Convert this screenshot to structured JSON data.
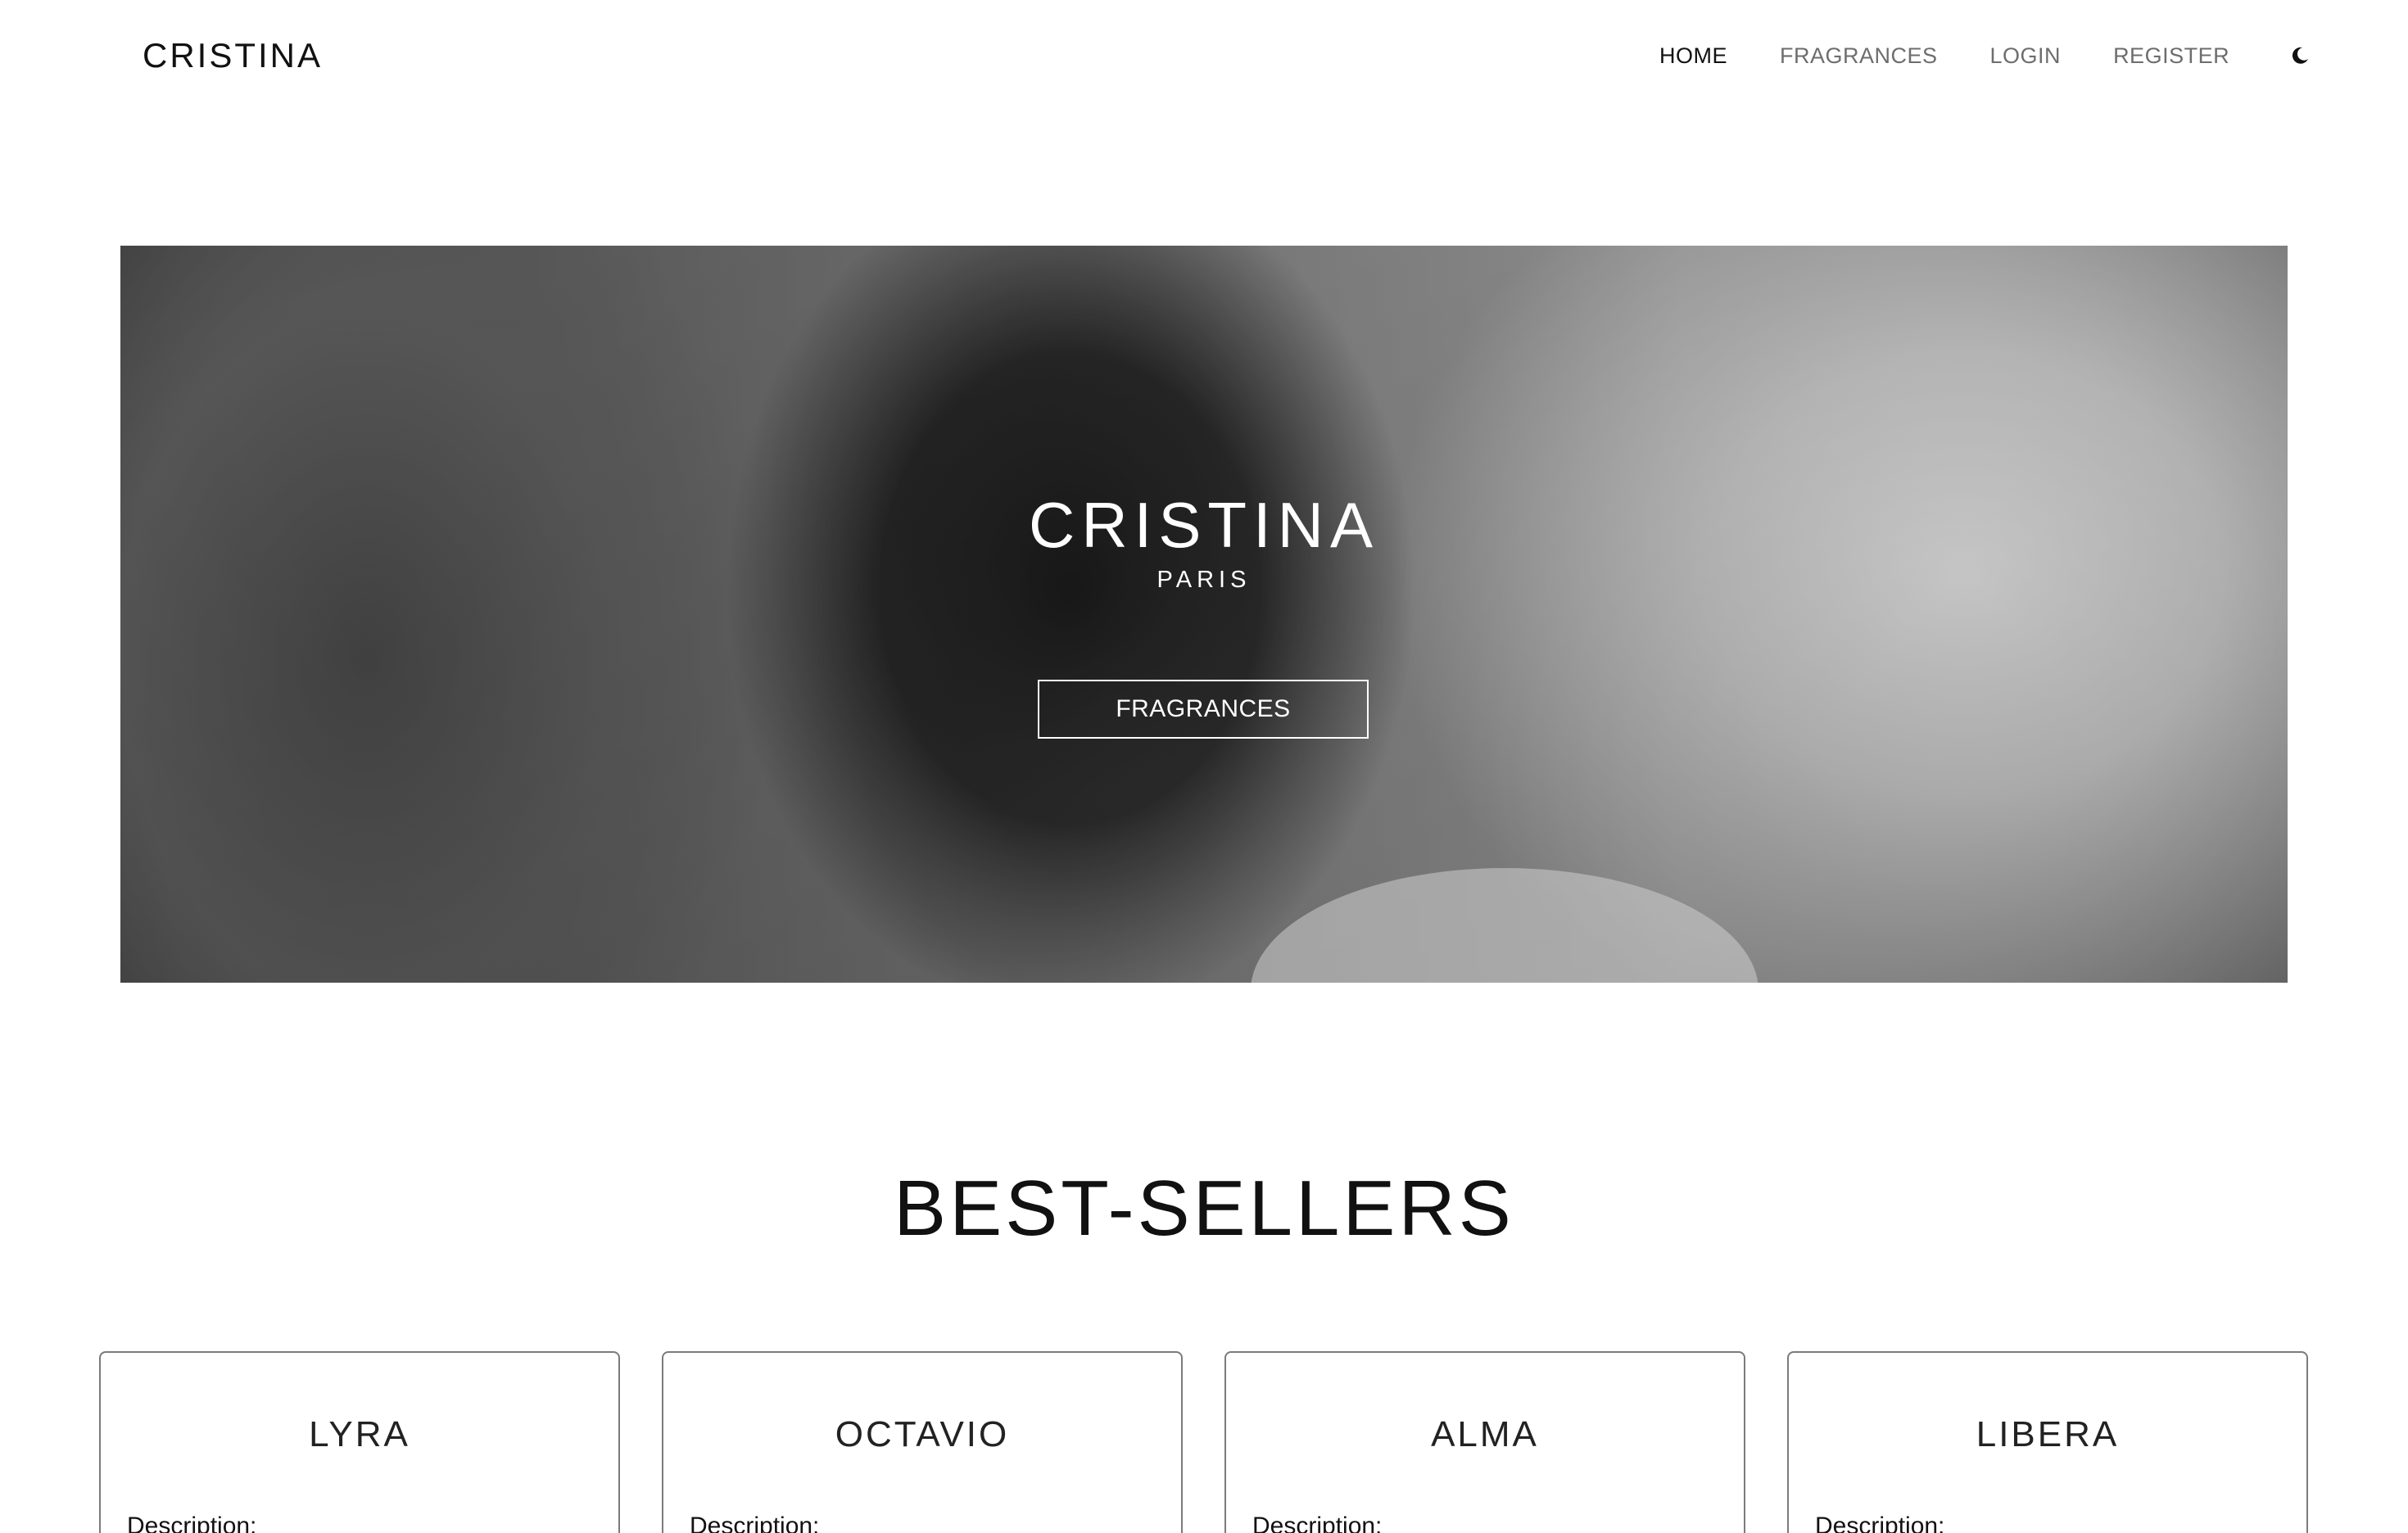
{
  "header": {
    "brand": "CRISTINA",
    "nav": {
      "home": "HOME",
      "fragrances": "FRAGRANCES",
      "login": "LOGIN",
      "register": "REGISTER"
    },
    "theme_toggle_icon": "moon-icon"
  },
  "hero": {
    "title": "CRISTINA",
    "subtitle": "PARIS",
    "button_label": "FRAGRANCES"
  },
  "best_sellers": {
    "title": "BEST-SELLERS",
    "products": [
      {
        "name": "LYRA",
        "description_label": "Description:"
      },
      {
        "name": "OCTAVIO",
        "description_label": "Description:"
      },
      {
        "name": "ALMA",
        "description_label": "Description:"
      },
      {
        "name": "LIBERA",
        "description_label": "Description:"
      }
    ]
  },
  "colors": {
    "text": "#111111",
    "nav_inactive": "#6d6d6d",
    "card_border": "#7b7b7b",
    "background": "#ffffff"
  }
}
